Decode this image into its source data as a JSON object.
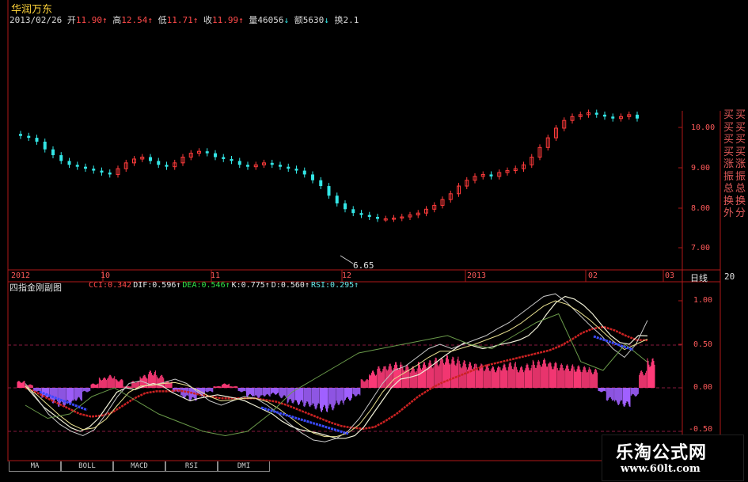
{
  "stock": {
    "name": "华润万东"
  },
  "quote": {
    "date": "2013/02/26",
    "open_label": "开",
    "open": "11.90",
    "high_label": "高",
    "high": "12.54",
    "low_label": "低",
    "low": "11.71",
    "close_label": "收",
    "close": "11.99",
    "volume_label": "量",
    "volume": "46056",
    "amount_label": "额",
    "amount": "5630",
    "turnover_label": "换",
    "turnover": "2.1"
  },
  "price_axis": {
    "ticks": [
      "10.00",
      "9.00",
      "8.00",
      "7.00"
    ]
  },
  "low_marker": "6.65",
  "date_axis": {
    "labels": [
      "2012",
      "10",
      "11",
      "12",
      "2013",
      "02",
      "03"
    ],
    "period": "日线",
    "period_count": "20"
  },
  "indicator": {
    "title": "四指金刚副图",
    "values": [
      {
        "label": "CCI:",
        "value": "0.342",
        "arrow": "",
        "color": "#ff4a4a"
      },
      {
        "label": "DIF:",
        "value": "0.596",
        "arrow": "↑",
        "color": "#e8e8e8"
      },
      {
        "label": "DEA:",
        "value": "0.546",
        "arrow": "↑",
        "color": "#33e64a"
      },
      {
        "label": "K:",
        "value": "0.775",
        "arrow": "↑",
        "color": "#e8e8e8"
      },
      {
        "label": "D:",
        "value": "0.560",
        "arrow": "↑",
        "color": "#e8e8e8"
      },
      {
        "label": "RSI:",
        "value": "0.295",
        "arrow": "↑",
        "color": "#66e6e6"
      }
    ],
    "axis_ticks": [
      "1.00",
      "0.50",
      "0.00",
      "-0.50"
    ]
  },
  "side_panel": {
    "col1": "买买买买涨振总换外",
    "col2": "买买买买涨振总换分"
  },
  "tabs": [
    "MA",
    "BOLL",
    "MACD",
    "RSI",
    "DMI"
  ],
  "watermark": {
    "line1": "乐淘公式网",
    "line2": "www.60lt.com"
  },
  "colors": {
    "up": "#ff3b3b",
    "down": "#33e6e6",
    "axis": "#b01818",
    "zero_line": "#8a1a40",
    "title": "#ffd43a"
  },
  "chart_data": [
    {
      "type": "candlestick",
      "title": "",
      "x_labels": [
        "2012",
        "10",
        "11",
        "12",
        "2013",
        "02",
        "03"
      ],
      "ylim": [
        6.5,
        10.5
      ],
      "y_ticks": [
        7.0,
        8.0,
        9.0,
        10.0
      ],
      "series": [
        {
          "close": [
            9.85,
            9.8,
            9.7,
            9.5,
            9.35,
            9.2,
            9.1,
            9.05,
            9.0,
            8.95,
            8.9,
            8.85,
            9.0,
            9.15,
            9.25,
            9.3,
            9.2,
            9.1,
            9.05,
            9.15,
            9.3,
            9.4,
            9.45,
            9.4,
            9.3,
            9.25,
            9.2,
            9.1,
            9.05,
            9.1,
            9.15,
            9.1,
            9.05,
            9.0,
            8.95,
            8.85,
            8.7,
            8.55,
            8.3,
            8.1,
            7.95,
            7.85,
            7.8,
            7.75,
            7.7,
            7.7,
            7.72,
            7.75,
            7.8,
            7.85,
            7.95,
            8.05,
            8.2,
            8.35,
            8.55,
            8.7,
            8.8,
            8.85,
            8.8,
            8.9,
            8.95,
            9.0,
            9.1,
            9.3,
            9.55,
            9.8,
            10.05,
            10.25,
            10.35,
            10.4,
            10.45,
            10.4,
            10.35,
            10.3,
            10.35,
            10.4,
            10.3
          ]
        }
      ]
    },
    {
      "type": "bar",
      "title": "",
      "ylim": [
        -0.5,
        1.0
      ],
      "y_ticks": [
        -0.5,
        0.0,
        0.5,
        1.0
      ],
      "series": [
        {
          "name": "CCI",
          "values": [
            0.08,
            0.04,
            -0.05,
            -0.12,
            -0.18,
            -0.22,
            -0.2,
            -0.15,
            -0.05,
            0.05,
            0.12,
            0.15,
            0.1,
            0.02,
            0.08,
            0.15,
            0.2,
            0.15,
            0.08,
            -0.05,
            -0.12,
            -0.15,
            -0.1,
            -0.05,
            0.02,
            0.05,
            0.02,
            -0.05,
            -0.1,
            -0.12,
            -0.1,
            -0.08,
            -0.12,
            -0.18,
            -0.2,
            -0.22,
            -0.25,
            -0.28,
            -0.26,
            -0.2,
            -0.15,
            -0.1,
            0.1,
            0.2,
            0.25,
            0.28,
            0.3,
            0.27,
            0.25,
            0.3,
            0.32,
            0.35,
            0.38,
            0.36,
            0.32,
            0.3,
            0.28,
            0.27,
            0.25,
            0.28,
            0.3,
            0.25,
            0.28,
            0.32,
            0.34,
            0.3,
            0.28,
            0.27,
            0.26,
            0.25,
            0.22,
            -0.05,
            -0.15,
            -0.2,
            -0.22,
            -0.1,
            0.2,
            0.342
          ]
        },
        {
          "name": "DIF",
          "values": [
            0.02,
            -0.1,
            -0.22,
            -0.3,
            -0.38,
            -0.46,
            -0.5,
            -0.45,
            -0.35,
            -0.2,
            -0.05,
            0.0,
            -0.02,
            0.02,
            0.05,
            0.02,
            -0.05,
            -0.1,
            -0.15,
            -0.12,
            -0.1,
            -0.08,
            -0.1,
            -0.12,
            -0.15,
            -0.2,
            -0.25,
            -0.3,
            -0.38,
            -0.44,
            -0.48,
            -0.5,
            -0.52,
            -0.55,
            -0.58,
            -0.58,
            -0.55,
            -0.45,
            -0.3,
            -0.15,
            0.0,
            0.1,
            0.12,
            0.15,
            0.22,
            0.3,
            0.38,
            0.45,
            0.52,
            0.48,
            0.45,
            0.47,
            0.5,
            0.52,
            0.55,
            0.6,
            0.7,
            0.85,
            0.98,
            1.05,
            1.02,
            0.95,
            0.85,
            0.72,
            0.6,
            0.52,
            0.5,
            0.6,
            0.596
          ]
        },
        {
          "name": "DEA",
          "values": [
            0.0,
            -0.05,
            -0.12,
            -0.18,
            -0.24,
            -0.3,
            -0.33,
            -0.32,
            -0.28,
            -0.2,
            -0.12,
            -0.06,
            -0.04,
            -0.04,
            -0.03,
            -0.05,
            -0.08,
            -0.1,
            -0.12,
            -0.12,
            -0.12,
            -0.12,
            -0.14,
            -0.16,
            -0.2,
            -0.25,
            -0.3,
            -0.35,
            -0.4,
            -0.44,
            -0.46,
            -0.47,
            -0.45,
            -0.38,
            -0.3,
            -0.2,
            -0.1,
            -0.02,
            0.05,
            0.1,
            0.15,
            0.2,
            0.25,
            0.28,
            0.31,
            0.34,
            0.37,
            0.4,
            0.43,
            0.48,
            0.55,
            0.63,
            0.68,
            0.7,
            0.66,
            0.6,
            0.55,
            0.546
          ]
        },
        {
          "name": "K",
          "values": [
            0.05,
            -0.12,
            -0.3,
            -0.42,
            -0.5,
            -0.55,
            -0.48,
            -0.3,
            -0.1,
            0.05,
            0.08,
            0.03,
            0.06,
            0.1,
            0.05,
            -0.05,
            -0.15,
            -0.2,
            -0.15,
            -0.1,
            -0.12,
            -0.2,
            -0.3,
            -0.42,
            -0.52,
            -0.6,
            -0.62,
            -0.58,
            -0.5,
            -0.35,
            -0.15,
            0.05,
            0.2,
            0.25,
            0.35,
            0.45,
            0.5,
            0.45,
            0.5,
            0.55,
            0.6,
            0.68,
            0.75,
            0.85,
            0.95,
            1.05,
            1.08,
            0.98,
            0.85,
            0.72,
            0.6,
            0.45,
            0.35,
            0.5,
            0.775
          ]
        },
        {
          "name": "D",
          "values": [
            0.02,
            -0.08,
            -0.2,
            -0.32,
            -0.42,
            -0.48,
            -0.46,
            -0.36,
            -0.2,
            -0.05,
            0.02,
            0.03,
            0.05,
            0.06,
            0.03,
            -0.03,
            -0.1,
            -0.15,
            -0.14,
            -0.12,
            -0.12,
            -0.16,
            -0.24,
            -0.34,
            -0.44,
            -0.52,
            -0.56,
            -0.56,
            -0.52,
            -0.42,
            -0.25,
            -0.05,
            0.1,
            0.18,
            0.26,
            0.35,
            0.42,
            0.42,
            0.46,
            0.5,
            0.55,
            0.6,
            0.66,
            0.74,
            0.84,
            0.94,
            1.0,
            0.96,
            0.88,
            0.78,
            0.66,
            0.54,
            0.44,
            0.5,
            0.56
          ]
        },
        {
          "name": "RSI",
          "values": [
            -0.2,
            -0.35,
            -0.3,
            -0.1,
            0.0,
            -0.15,
            -0.3,
            -0.4,
            -0.5,
            -0.55,
            -0.5,
            -0.3,
            -0.05,
            0.1,
            0.25,
            0.4,
            0.45,
            0.5,
            0.55,
            0.6,
            0.5,
            0.45,
            0.6,
            0.75,
            0.85,
            0.3,
            0.2,
            0.5,
            0.295
          ]
        }
      ]
    }
  ]
}
